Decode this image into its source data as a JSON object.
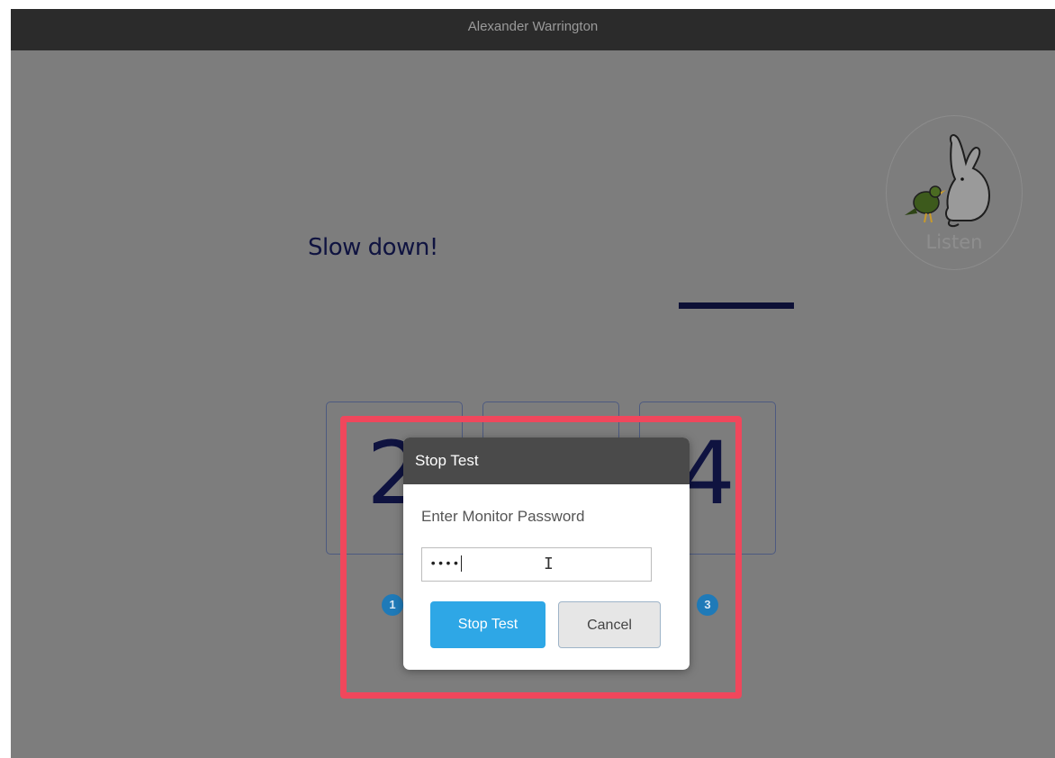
{
  "window": {
    "title": "Alexander Warrington"
  },
  "question": {
    "prompt": "Slow down!"
  },
  "listen": {
    "label": "Listen",
    "icon": "rabbit-and-bird-icon"
  },
  "choices": [
    {
      "value": "2",
      "badge": "1"
    },
    {
      "value": "",
      "badge": ""
    },
    {
      "value": "4",
      "badge": "3"
    }
  ],
  "dialog": {
    "title": "Stop Test",
    "label": "Enter Monitor Password",
    "password_value": "••••",
    "stop_label": "Stop Test",
    "cancel_label": "Cancel"
  },
  "colors": {
    "highlight": "#f0475c",
    "primary_button": "#2ea7e6",
    "badge": "#1f7ab8"
  }
}
